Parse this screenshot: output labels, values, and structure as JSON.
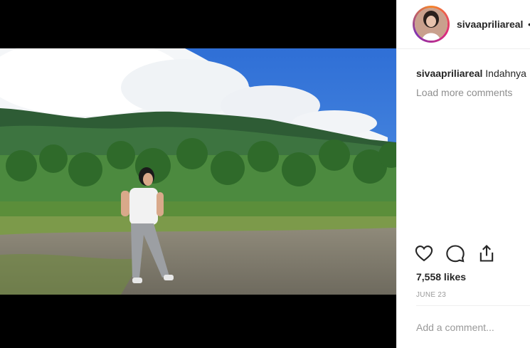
{
  "post": {
    "username": "sivaapriliareal",
    "caption_text": "Indahnya",
    "load_more": "Load more comments",
    "likes": "7,558 likes",
    "date": "JUNE 23",
    "add_comment_placeholder": "Add a comment..."
  },
  "icons": {
    "like": "heart-icon",
    "comment": "comment-icon",
    "share": "share-icon"
  },
  "colors": {
    "text": "#262626",
    "muted": "#8e8e8e",
    "divider": "#efefef"
  }
}
